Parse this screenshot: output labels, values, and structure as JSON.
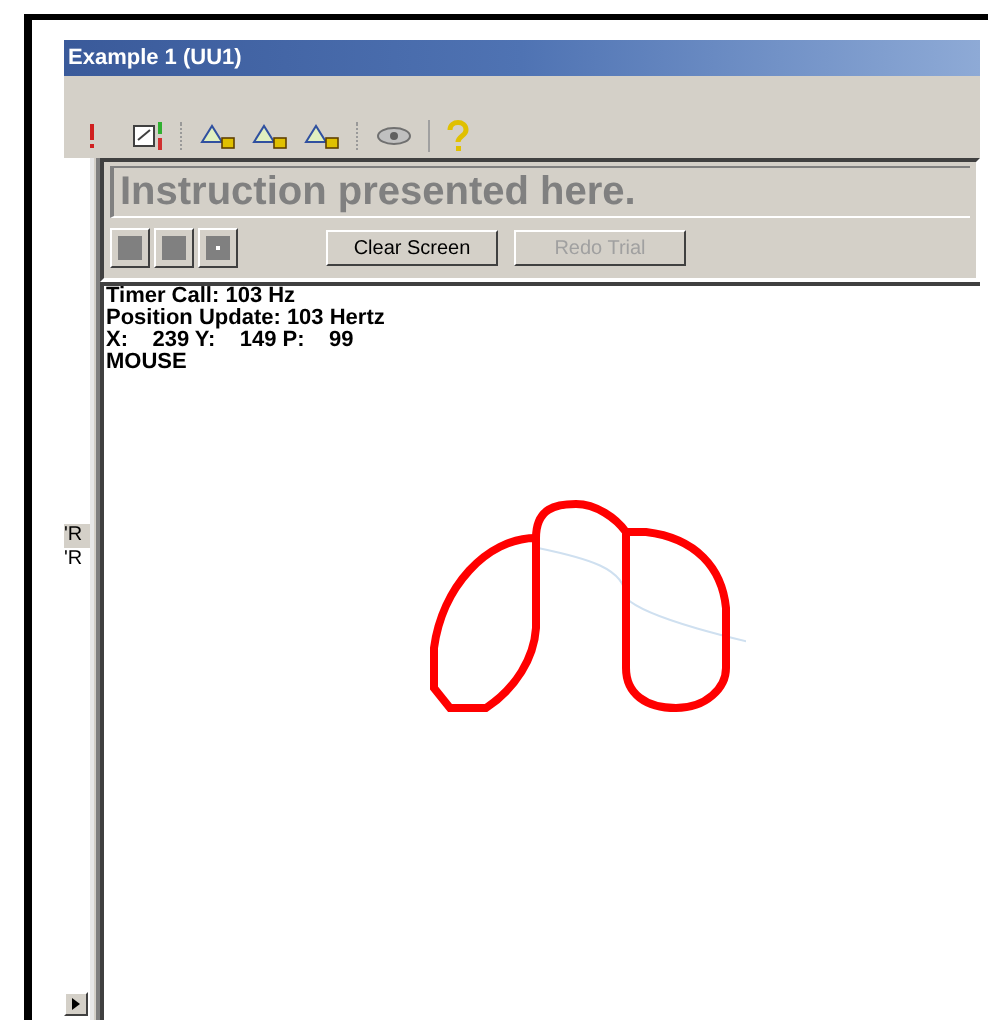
{
  "window": {
    "title": "Example 1 (UU1)"
  },
  "side_panel": {
    "items": [
      {
        "label": "'R",
        "selected": true
      },
      {
        "label": "'R",
        "selected": false
      }
    ]
  },
  "instruction": {
    "text": "Instruction presented here."
  },
  "buttons": [
    {
      "label": "Clear Screen",
      "disabled": false
    },
    {
      "label": "Redo Trial",
      "disabled": true
    }
  ],
  "readout": [
    "Timer Call: 103 Hz",
    "Position Update: 103 Hertz",
    "X:    239 Y:    149 P:    99",
    "MOUSE"
  ]
}
